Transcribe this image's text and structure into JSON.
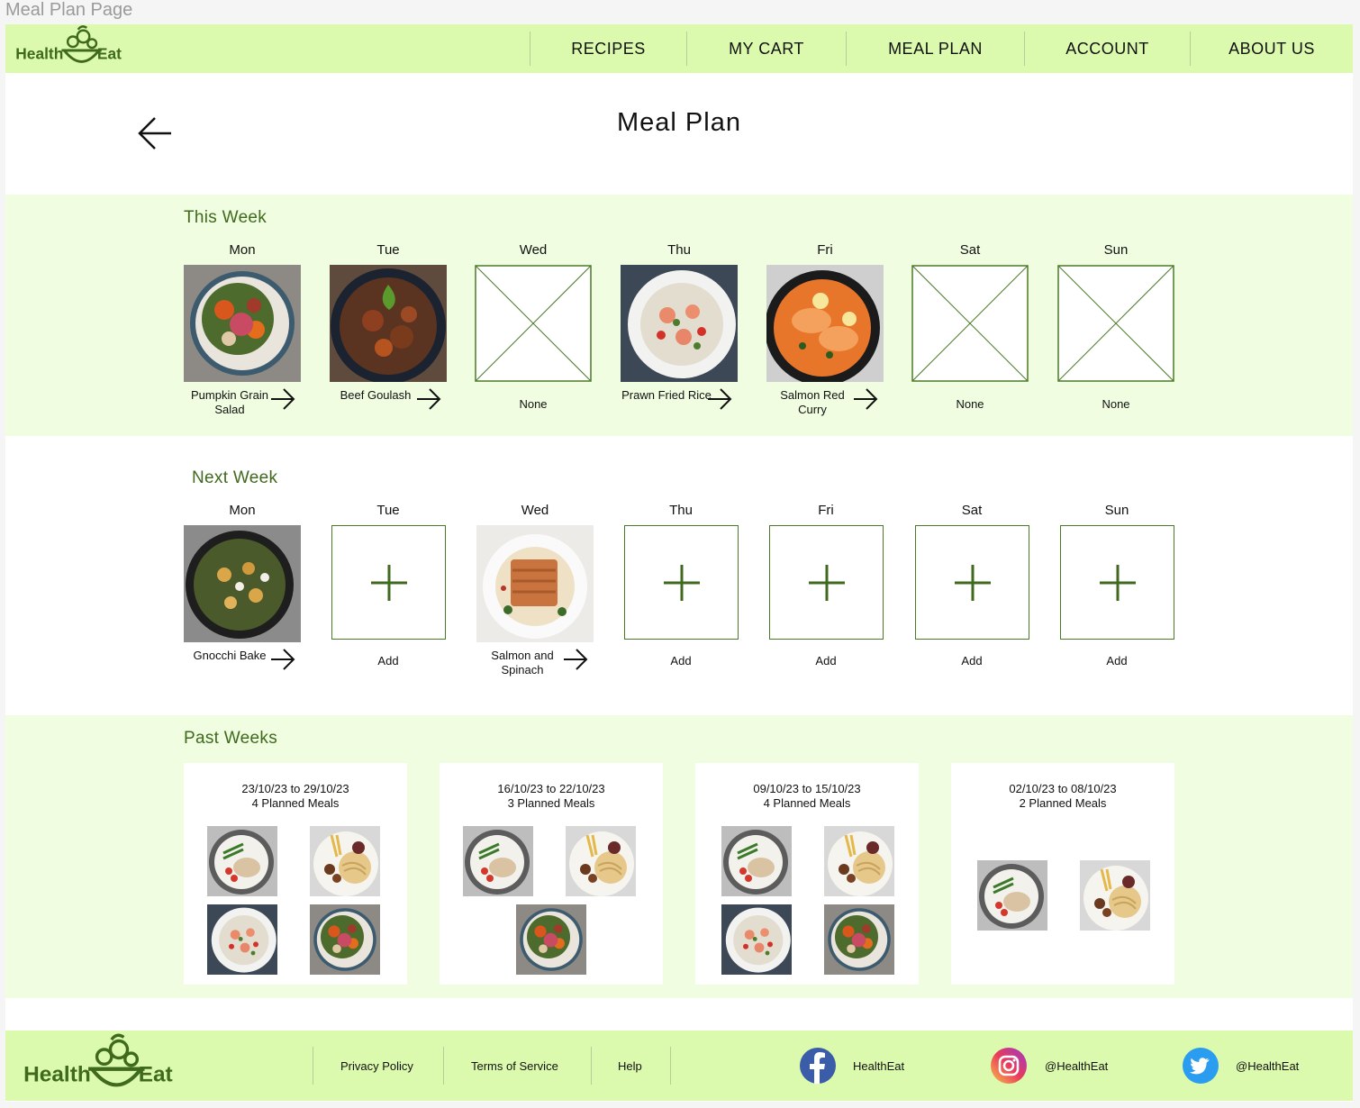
{
  "frame_title": "Meal Plan Page",
  "brand": {
    "left": "Health",
    "right": "Eat"
  },
  "nav": [
    "RECIPES",
    "MY CART",
    "MEAL PLAN",
    "ACCOUNT",
    "ABOUT US"
  ],
  "page_title": "Meal Plan",
  "this_week": {
    "title": "This Week",
    "days": [
      {
        "day": "Mon",
        "meal": "Pumpkin Grain Salad"
      },
      {
        "day": "Tue",
        "meal": "Beef Goulash"
      },
      {
        "day": "Wed",
        "meal": "None"
      },
      {
        "day": "Thu",
        "meal": "Prawn Fried Rice"
      },
      {
        "day": "Fri",
        "meal": "Salmon Red Curry"
      },
      {
        "day": "Sat",
        "meal": "None"
      },
      {
        "day": "Sun",
        "meal": "None"
      }
    ]
  },
  "next_week": {
    "title": "Next Week",
    "days": [
      {
        "day": "Mon",
        "meal": "Gnocchi Bake"
      },
      {
        "day": "Tue",
        "meal": "Add"
      },
      {
        "day": "Wed",
        "meal": "Salmon and Spinach"
      },
      {
        "day": "Thu",
        "meal": "Add"
      },
      {
        "day": "Fri",
        "meal": "Add"
      },
      {
        "day": "Sat",
        "meal": "Add"
      },
      {
        "day": "Sun",
        "meal": "Add"
      }
    ]
  },
  "past_weeks": {
    "title": "Past Weeks",
    "cards": [
      {
        "range": "23/10/23 to 29/10/23",
        "count": "4 Planned Meals"
      },
      {
        "range": "16/10/23 to 22/10/23",
        "count": "3 Planned Meals"
      },
      {
        "range": "09/10/23 to 15/10/23",
        "count": "4 Planned Meals"
      },
      {
        "range": "02/10/23 to 08/10/23",
        "count": "2 Planned Meals"
      }
    ]
  },
  "footer": {
    "links": [
      "Privacy Policy",
      "Terms of Service",
      "Help"
    ],
    "social": [
      {
        "icon": "facebook-icon",
        "handle": "HealthEat"
      },
      {
        "icon": "instagram-icon",
        "handle": "@HealthEat"
      },
      {
        "icon": "twitter-icon",
        "handle": "@HealthEat"
      }
    ]
  },
  "colors": {
    "header_bg": "#dcfaad",
    "band_bg": "#f0fde0",
    "accent": "#3f6a1d"
  }
}
